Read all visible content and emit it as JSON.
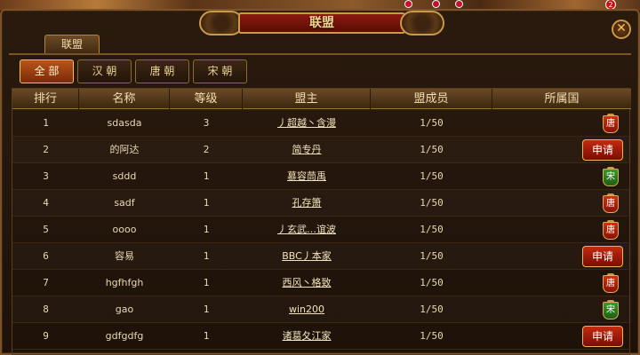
{
  "window": {
    "title": "联盟",
    "tab_label": "联盟",
    "close_symbol": "✕"
  },
  "header_badge": "2",
  "filters": [
    {
      "label": "全 部",
      "active": true
    },
    {
      "label": "汉 朝",
      "active": false
    },
    {
      "label": "唐 朝",
      "active": false
    },
    {
      "label": "宋 朝",
      "active": false
    }
  ],
  "table": {
    "columns": [
      "排行",
      "名称",
      "等级",
      "盟主",
      "盟成员",
      "所属国"
    ],
    "apply_label": "申请",
    "rows": [
      {
        "rank": "1",
        "name": "sdasda",
        "level": "3",
        "leader": "丿超越丶含漫",
        "members": "1/50",
        "country": "唐",
        "country_type": "tang"
      },
      {
        "rank": "2",
        "name": "的阿达",
        "level": "2",
        "leader": "简专丹",
        "members": "1/50",
        "country": "apply",
        "country_type": "apply"
      },
      {
        "rank": "3",
        "name": "sddd",
        "level": "1",
        "leader": "慕容茼禹",
        "members": "1/50",
        "country": "宋",
        "country_type": "song"
      },
      {
        "rank": "4",
        "name": "sadf",
        "level": "1",
        "leader": "孔存箫",
        "members": "1/50",
        "country": "唐",
        "country_type": "tang"
      },
      {
        "rank": "5",
        "name": "oooo",
        "level": "1",
        "leader": "丿玄武…谊波",
        "members": "1/50",
        "country": "唐",
        "country_type": "tang"
      },
      {
        "rank": "6",
        "name": "容易",
        "level": "1",
        "leader": "BBC丿本家",
        "members": "1/50",
        "country": "apply",
        "country_type": "apply"
      },
      {
        "rank": "7",
        "name": "hgfhfgh",
        "level": "1",
        "leader": "西风丶格致",
        "members": "1/50",
        "country": "唐",
        "country_type": "tang"
      },
      {
        "rank": "8",
        "name": "gao",
        "level": "1",
        "leader": "win200",
        "members": "1/50",
        "country": "宋",
        "country_type": "song"
      },
      {
        "rank": "9",
        "name": "gdfgdfg",
        "level": "1",
        "leader": "诸葛夂江家",
        "members": "1/50",
        "country": "apply",
        "country_type": "apply"
      }
    ]
  },
  "colors": {
    "accent_gold": "#c99a48",
    "title_red": "#8a1a0f",
    "tang_red": "#d03010",
    "song_green": "#3a9a2a"
  }
}
